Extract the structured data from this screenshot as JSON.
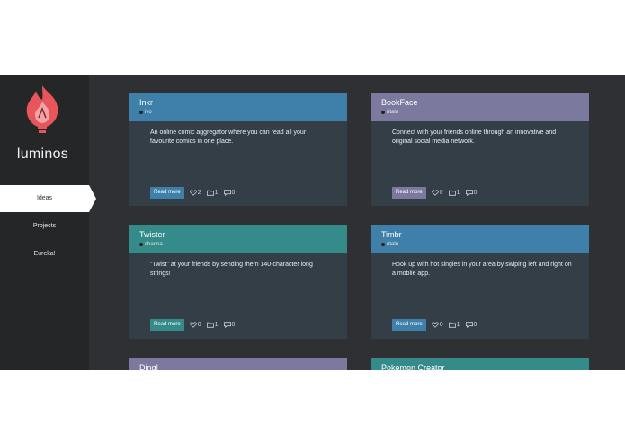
{
  "brand": {
    "name": "luminos"
  },
  "nav": [
    {
      "label": "Ideas",
      "active": true
    },
    {
      "label": "Projects",
      "active": false
    },
    {
      "label": "Eureka!",
      "active": false
    }
  ],
  "colors": {
    "blue": "#3e80aa",
    "purple": "#7b7a9e",
    "teal": "#348b8a",
    "card_body": "#333e46"
  },
  "cards": [
    {
      "title": "Inkr",
      "author": "ivo",
      "desc": "An online comic aggregator where you can read all your favourite comics in one place.",
      "button": "Read more",
      "likes": "2",
      "projects": "1",
      "comments": "0",
      "color": "#3e80aa"
    },
    {
      "title": "BookFace",
      "author": "ritalu",
      "desc": "Connect with your friends online through an innovative and original social media network.",
      "button": "Read more",
      "likes": "0",
      "projects": "1",
      "comments": "0",
      "color": "#7b7a9e"
    },
    {
      "title": "Twister",
      "author": "shanna",
      "desc": "\"Twist\" at your friends by sending them 140-character long strings!",
      "button": "Read more",
      "likes": "0",
      "projects": "1",
      "comments": "0",
      "color": "#348b8a"
    },
    {
      "title": "Timbr",
      "author": "ritalu",
      "desc": "Hook up with hot singles in your area by swiping left and right on a mobile app.",
      "button": "Read more",
      "likes": "0",
      "projects": "1",
      "comments": "0",
      "color": "#3e80aa"
    },
    {
      "title": "Ding!",
      "color": "#7b7a9e"
    },
    {
      "title": "Pokemon Creator",
      "color": "#348b8a"
    }
  ]
}
